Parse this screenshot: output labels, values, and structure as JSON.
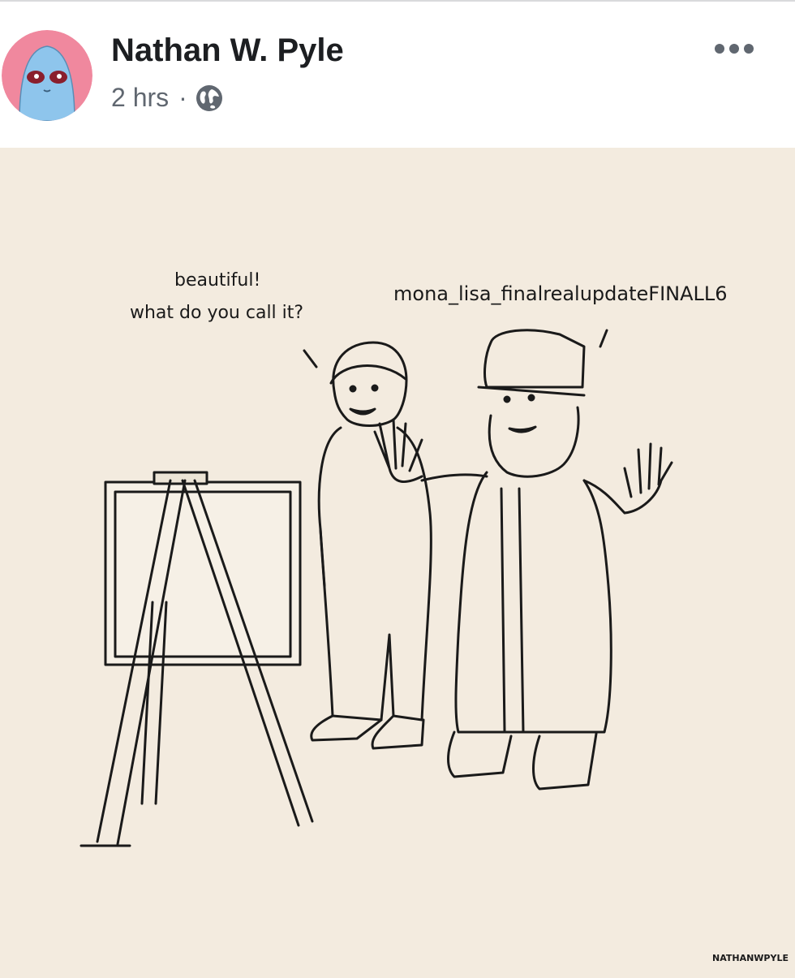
{
  "post": {
    "author": "Nathan W. Pyle",
    "timestamp": "2 hrs",
    "separator": "·",
    "privacy_icon": "globe-icon",
    "more_icon": "more-options-icon"
  },
  "comic": {
    "speech_left_line1": "beautiful!",
    "speech_left_line2": "what do you call it?",
    "speech_right": "mona_lisa_finalrealupdateFINALL6",
    "signature": "NATHANWPYLE"
  },
  "colors": {
    "comic_background": "#f3ebdf",
    "ink": "#1a1a1a",
    "avatar_ring": "#f0889e",
    "avatar_face": "#8ec5ec",
    "text_primary": "#1c1e21",
    "text_secondary": "#606770"
  }
}
